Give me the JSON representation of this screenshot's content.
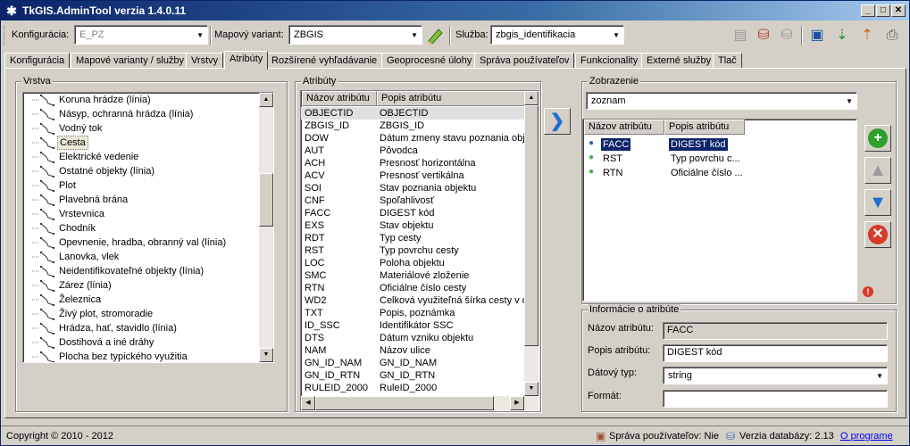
{
  "window": {
    "title": "TkGIS.AdminTool verzia 1.4.0.11",
    "buttons": {
      "minimize": "_",
      "maximize": "□",
      "close": "✕"
    }
  },
  "toolbar": {
    "konfiguracia_label": "Konfigurácia:",
    "konfiguracia_value": "E_PZ",
    "mapovy_variant_label": "Mapový variant:",
    "mapovy_variant_value": "ZBGIS",
    "sluzba_label": "Služba:",
    "sluzba_value": "zbgis_identifikacia"
  },
  "tabs": [
    {
      "label": "Konfigurácia"
    },
    {
      "label": "Mapové varianty / služby"
    },
    {
      "label": "Vrstvy"
    },
    {
      "label": "Atribúty"
    },
    {
      "label": "Rozšírené vyhľadávanie"
    },
    {
      "label": "Geoprocesné úlohy"
    },
    {
      "label": "Správa používateľov"
    },
    {
      "label": "Funkcionality"
    },
    {
      "label": "Externé služby"
    },
    {
      "label": "Tlač"
    }
  ],
  "vrstva": {
    "title": "Vrstva",
    "items": [
      {
        "label": "Koruna hrádze (línia)"
      },
      {
        "label": "Násyp, ochranná hrádza (línia)"
      },
      {
        "label": "Vodný tok"
      },
      {
        "label": "Cesta"
      },
      {
        "label": "Elektrické vedenie"
      },
      {
        "label": "Ostatné objekty (línia)"
      },
      {
        "label": "Plot"
      },
      {
        "label": "Plavebná brána"
      },
      {
        "label": "Vrstevnica"
      },
      {
        "label": "Chodník"
      },
      {
        "label": "Opevnenie, hradba, obranný val (línia)"
      },
      {
        "label": "Lanovka, vlek"
      },
      {
        "label": "Neidentifikovateľné objekty (línia)"
      },
      {
        "label": "Zárez (línia)"
      },
      {
        "label": "Železnica"
      },
      {
        "label": "Živý plot, stromoradie"
      },
      {
        "label": "Hrádza, hať, stavidlo (línia)"
      },
      {
        "label": "Dostihová a iné dráhy"
      },
      {
        "label": "Plocha bez typického využitia"
      }
    ]
  },
  "atributy": {
    "title": "Atribúty",
    "col1": "Názov atribútu",
    "col2": "Popis atribútu",
    "rows": [
      {
        "name": "OBJECTID",
        "desc": "OBJECTID"
      },
      {
        "name": "ZBGIS_ID",
        "desc": "ZBGIS_ID"
      },
      {
        "name": "DOW",
        "desc": "Dátum zmeny stavu poznania objek"
      },
      {
        "name": "AUT",
        "desc": "Pôvodca"
      },
      {
        "name": "ACH",
        "desc": "Presnosť horizontálna"
      },
      {
        "name": "ACV",
        "desc": "Presnosť vertikálna"
      },
      {
        "name": "SOI",
        "desc": "Stav poznania objektu"
      },
      {
        "name": "CNF",
        "desc": "Spoľahlivosť"
      },
      {
        "name": "FACC",
        "desc": "DIGEST kód"
      },
      {
        "name": "EXS",
        "desc": "Stav objektu"
      },
      {
        "name": "RDT",
        "desc": "Typ cesty"
      },
      {
        "name": "RST",
        "desc": "Typ povrchu cesty"
      },
      {
        "name": "LOC",
        "desc": "Poloha objektu"
      },
      {
        "name": "SMC",
        "desc": "Materiálové zloženie"
      },
      {
        "name": "RTN",
        "desc": "Oficiálne číslo cesty"
      },
      {
        "name": "WD2",
        "desc": "Celková využiteľná šírka cesty v d"
      },
      {
        "name": "TXT",
        "desc": "Popis, poznámka"
      },
      {
        "name": "ID_SSC",
        "desc": "Identifikátor SSC"
      },
      {
        "name": "DTS",
        "desc": "Dátum vzniku objektu"
      },
      {
        "name": "NAM",
        "desc": "Názov ulice"
      },
      {
        "name": "GN_ID_NAM",
        "desc": "GN_ID_NAM"
      },
      {
        "name": "GN_ID_RTN",
        "desc": "GN_ID_RTN"
      },
      {
        "name": "RULEID_2000",
        "desc": "RuleID_2000"
      }
    ]
  },
  "zobrazenie": {
    "title": "Zobrazenie",
    "mode": "zoznam",
    "col1": "Názov atribútu",
    "col2": "Popis atribútu",
    "rows": [
      {
        "name": "FACC",
        "desc": "DIGEST kód"
      },
      {
        "name": "RST",
        "desc": "Typ povrchu c..."
      },
      {
        "name": "RTN",
        "desc": "Oficiálne číslo ..."
      }
    ]
  },
  "info": {
    "title": "Informácie o atribúte",
    "nazov_label": "Názov atribútu:",
    "nazov_value": "FACC",
    "popis_label": "Popis atribútu:",
    "popis_value": "DIGEST kód",
    "typ_label": "Dátový typ:",
    "typ_value": "string",
    "format_label": "Formát:",
    "format_value": ""
  },
  "status": {
    "copyright": "Copyright ©  2010 - 2012",
    "users": "Správa používateľov: Nie",
    "db_version": "Verzia databázy: 2.13",
    "about": "O programe"
  },
  "colors": {
    "title_start": "#0a246a",
    "title_end": "#a6caf0",
    "selection": "#0a246a"
  }
}
